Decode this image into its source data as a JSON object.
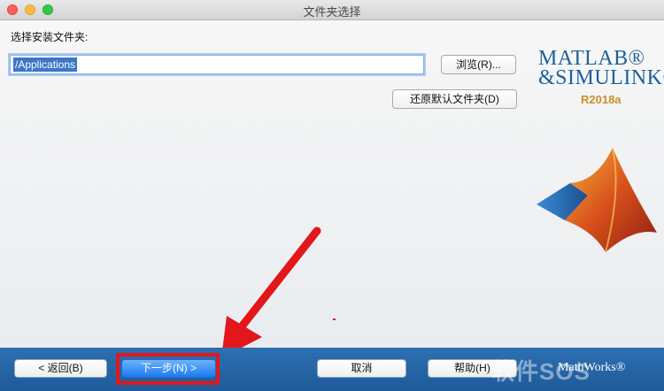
{
  "window": {
    "title": "文件夹选择"
  },
  "main": {
    "prompt": "选择安装文件夹:",
    "path_value": "/Applications",
    "browse_label": "浏览(R)...",
    "restore_default_label": "还原默认文件夹(D)"
  },
  "branding": {
    "matlab": "MATLAB®",
    "simulink": "&SIMULINK®",
    "release": "R2018a"
  },
  "footer": {
    "back_label": "< 返回(B)",
    "next_label": "下一步(N) >",
    "cancel_label": "取消",
    "help_label": "帮助(H)",
    "mathworks_label": "MathWorks®",
    "watermark": "软件SOS"
  },
  "colors": {
    "footer_bg": "#2266a8",
    "highlight": "#e3161c",
    "arrow": "#e3161c"
  }
}
